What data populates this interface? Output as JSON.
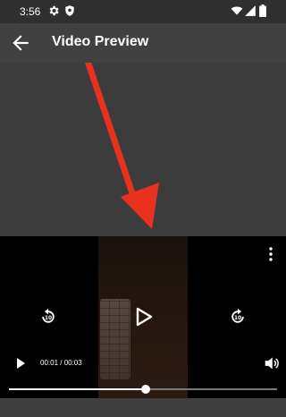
{
  "status": {
    "time": "3:56",
    "icons": [
      "gear-icon",
      "shield-icon",
      "wifi-icon",
      "signal-icon",
      "battery-icon"
    ]
  },
  "app_bar": {
    "title": "Video Preview",
    "back_icon": "arrow-left-icon"
  },
  "player": {
    "time_text": "00:01 / 00:03",
    "progress": 0.51,
    "controls": [
      "replay-10-icon",
      "play-icon",
      "forward-10-icon",
      "play-small-icon",
      "volume-icon",
      "more-vert-icon"
    ]
  },
  "colors": {
    "annotation_arrow": "#e8321f",
    "video_bg": "#000000"
  }
}
